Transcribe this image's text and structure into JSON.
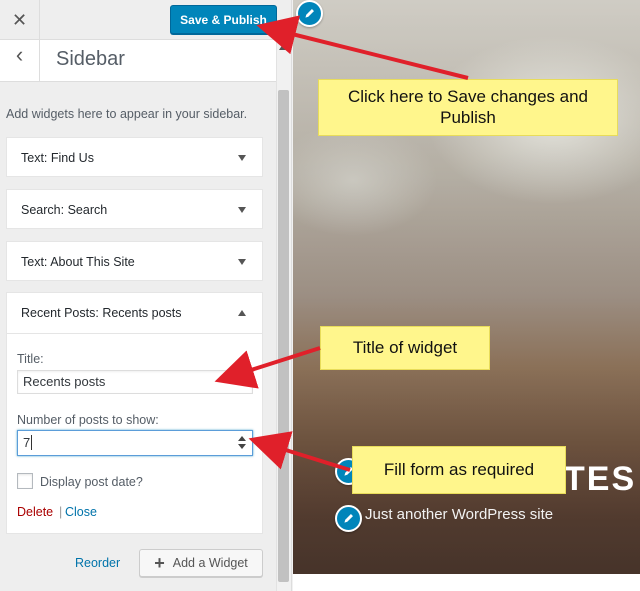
{
  "topbar": {
    "close_glyph": "✕",
    "publish_label": "Save & Publish"
  },
  "section": {
    "back_glyph": "‹",
    "title": "Sidebar",
    "description": "Add widgets here to appear in your sidebar."
  },
  "widgets": [
    {
      "type": "Text:",
      "name": "Find Us",
      "expanded": false
    },
    {
      "type": "Search:",
      "name": "Search",
      "expanded": false
    },
    {
      "type": "Text:",
      "name": "About This Site",
      "expanded": false
    },
    {
      "type": "Recent Posts:",
      "name": "Recents posts",
      "expanded": true
    }
  ],
  "recent_posts_form": {
    "title_label": "Title:",
    "title_value": "Recents posts",
    "count_label": "Number of posts to show:",
    "count_value": "7",
    "show_date_label": "Display post date?",
    "show_date_checked": false,
    "delete_label": "Delete",
    "separator": "|",
    "close_label": "Close"
  },
  "footer": {
    "reorder_label": "Reorder",
    "add_widget_label": "Add a Widget"
  },
  "preview": {
    "site_title_fragment": "TES",
    "tagline": "Just another WordPress site"
  },
  "annotations": {
    "publish_note": "Click here to Save changes and Publish",
    "title_note": "Title of widget",
    "form_note": "Fill form as required"
  },
  "colors": {
    "primary_button": "#0085ba",
    "callout_fill": "#fff68c",
    "arrow": "#e0202a",
    "delete_link": "#aa0000",
    "link": "#0073aa"
  }
}
